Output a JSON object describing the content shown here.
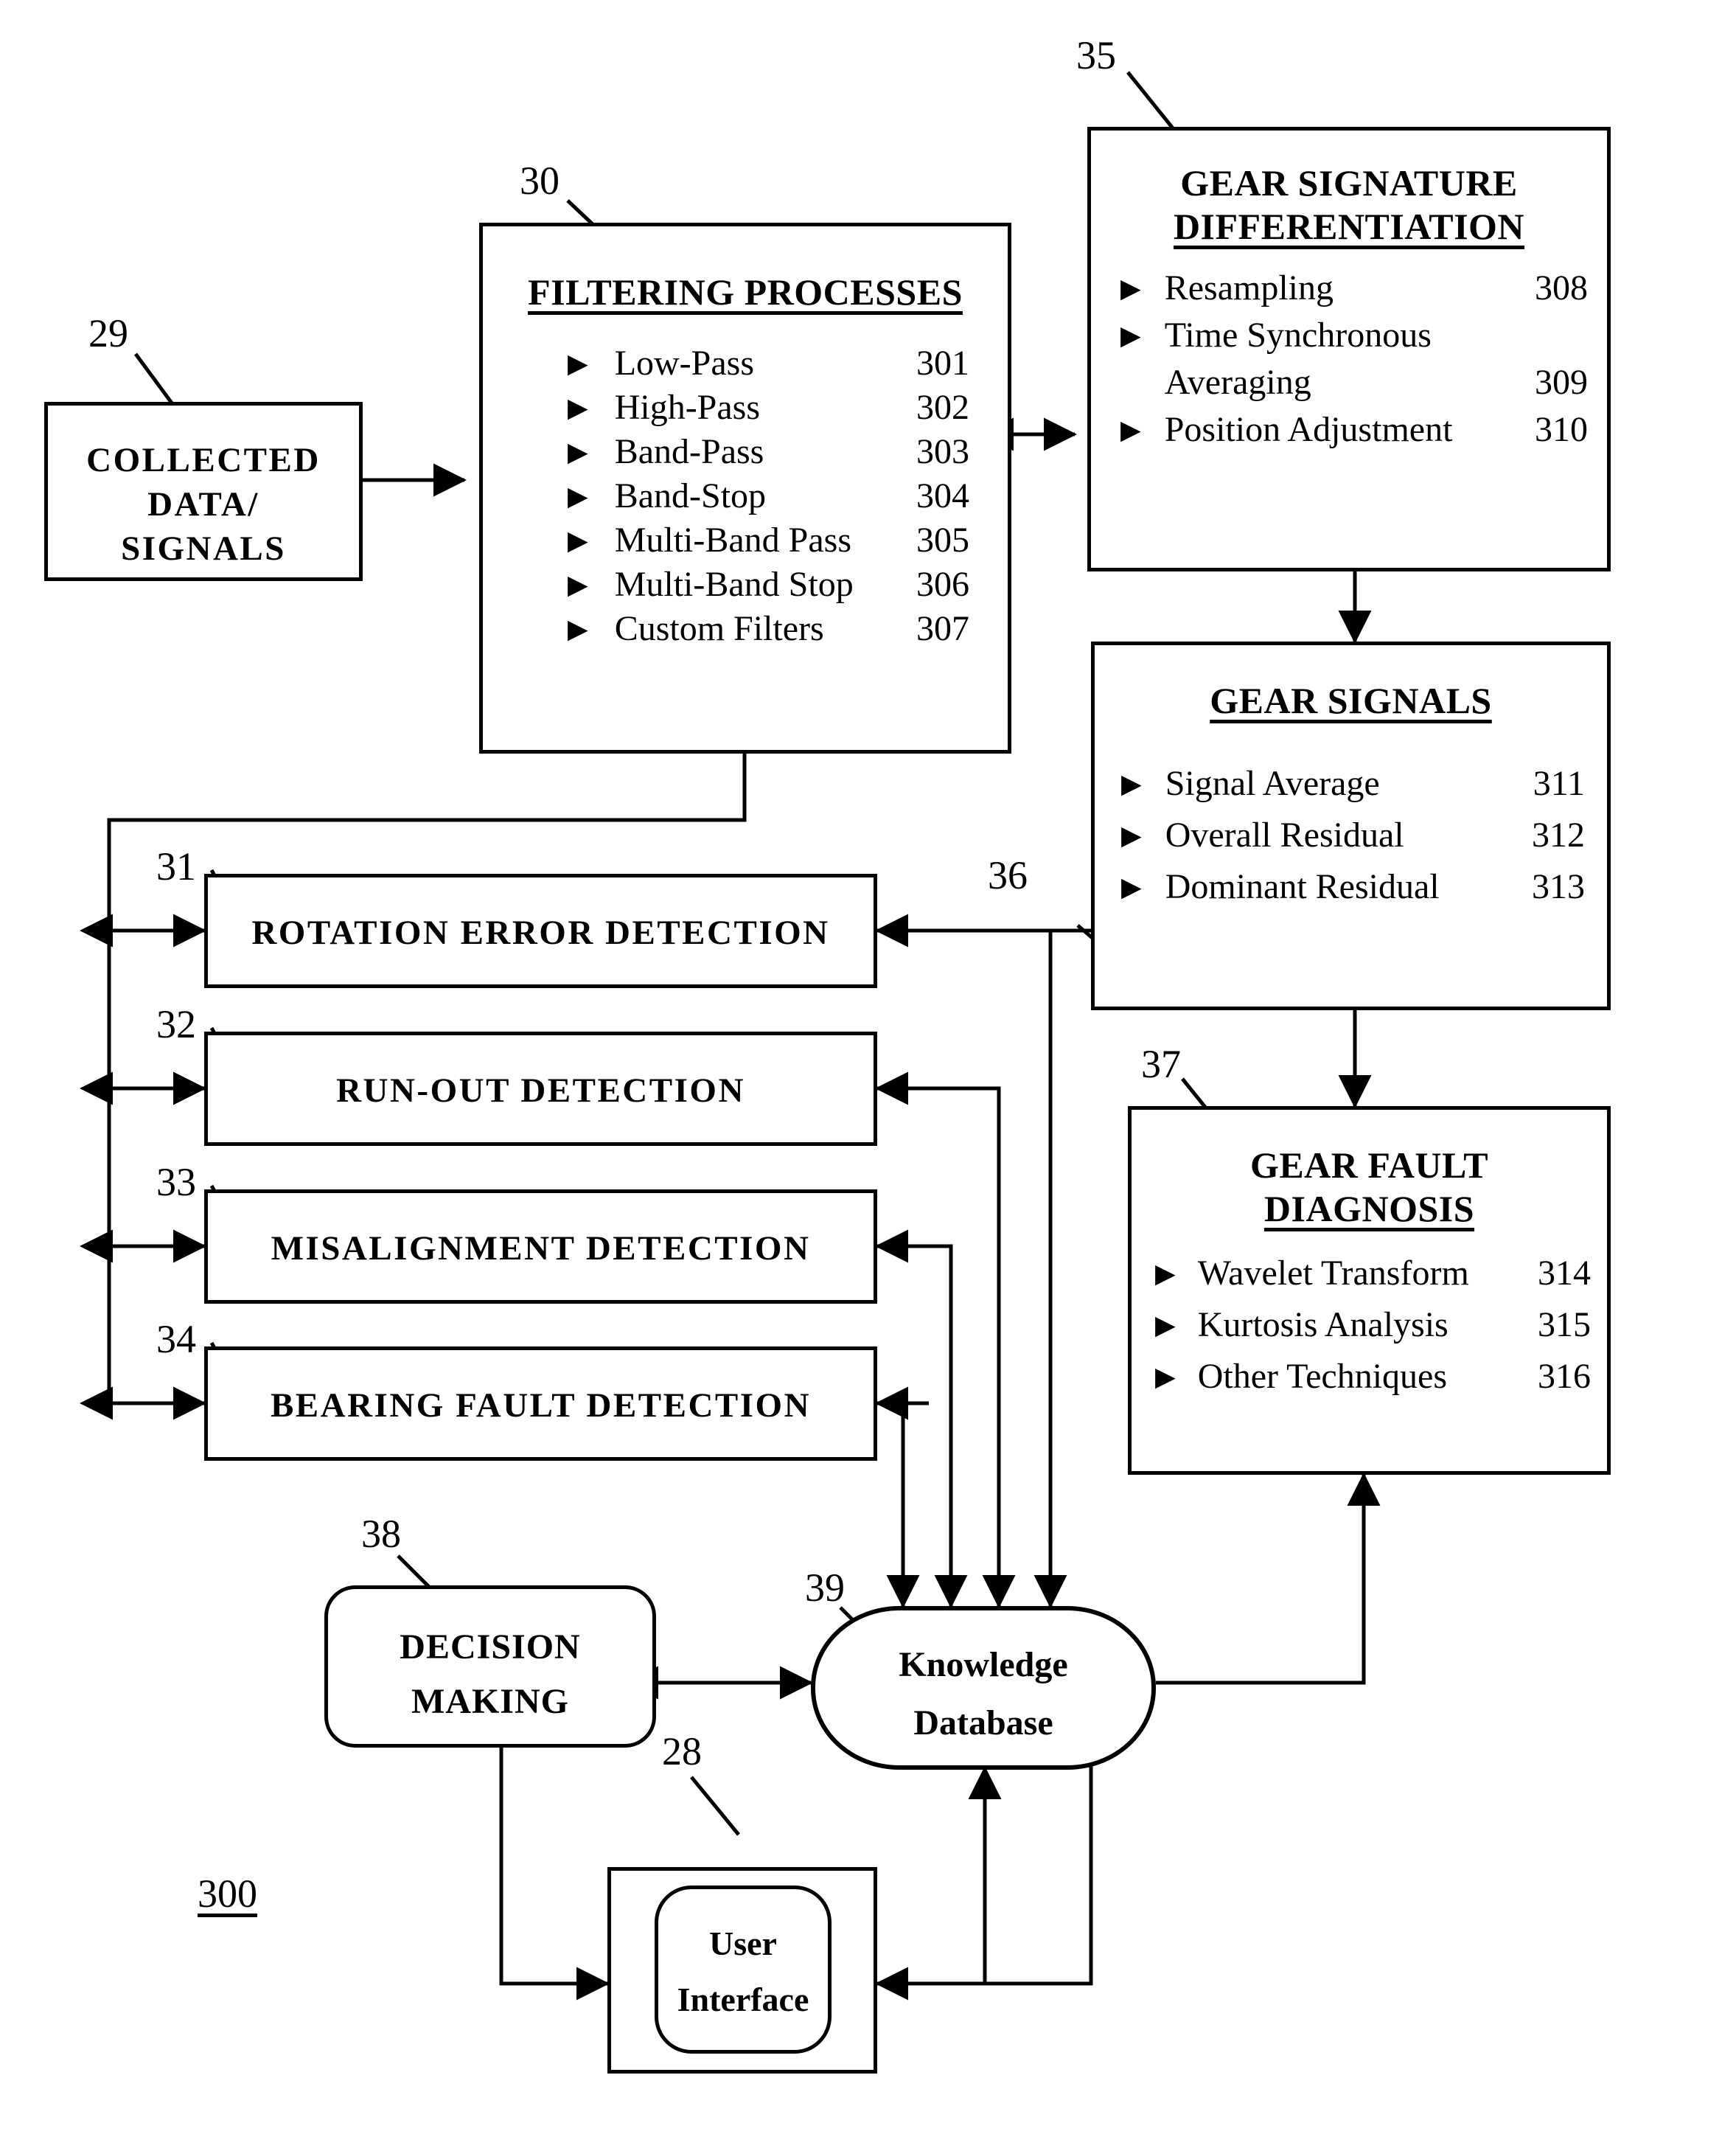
{
  "figure": {
    "number": "300"
  },
  "blocks": {
    "collected_data": {
      "ref": "29",
      "lines": [
        "COLLECTED",
        "DATA/",
        "SIGNALS"
      ]
    },
    "filtering_processes": {
      "ref": "30",
      "title": "FILTERING PROCESSES",
      "items": [
        {
          "bullet": "▶",
          "label": "Low-Pass",
          "num": "301"
        },
        {
          "bullet": "▶",
          "label": "High-Pass",
          "num": "302"
        },
        {
          "bullet": "▶",
          "label": "Band-Pass",
          "num": "303"
        },
        {
          "bullet": "▶",
          "label": "Band-Stop",
          "num": "304"
        },
        {
          "bullet": "▶",
          "label": "Multi-Band Pass",
          "num": "305"
        },
        {
          "bullet": "▶",
          "label": "Multi-Band Stop",
          "num": "306"
        },
        {
          "bullet": "▶",
          "label": "Custom Filters",
          "num": "307"
        }
      ]
    },
    "gear_signature_differentiation": {
      "ref": "35",
      "title_line1": "GEAR SIGNATURE",
      "title_line2": "DIFFERENTIATION",
      "items": [
        {
          "bullet": "▶",
          "label": "Resampling",
          "num": "308"
        },
        {
          "bullet": "▶",
          "label": "Time Synchronous",
          "num": ""
        },
        {
          "bullet": "",
          "label": "Averaging",
          "num": "309"
        },
        {
          "bullet": "▶",
          "label": "Position Adjustment",
          "num": "310"
        }
      ]
    },
    "gear_signals": {
      "ref": "36",
      "title": "GEAR  SIGNALS",
      "items": [
        {
          "bullet": "▶",
          "label": "Signal Average",
          "num": "311"
        },
        {
          "bullet": "▶",
          "label": "Overall Residual",
          "num": "312"
        },
        {
          "bullet": "▶",
          "label": "Dominant Residual",
          "num": "313"
        }
      ]
    },
    "gear_fault_diagnosis": {
      "ref": "37",
      "title_line1": "GEAR  FAULT",
      "title_line2": "DIAGNOSIS",
      "items": [
        {
          "bullet": "▶",
          "label": "Wavelet Transform",
          "num": "314"
        },
        {
          "bullet": "▶",
          "label": "Kurtosis Analysis",
          "num": "315"
        },
        {
          "bullet": "▶",
          "label": "Other Techniques",
          "num": "316"
        }
      ]
    },
    "rotation_error_detection": {
      "ref": "31",
      "label": "ROTATION  ERROR  DETECTION"
    },
    "run_out_detection": {
      "ref": "32",
      "label": "RUN-OUT  DETECTION"
    },
    "misalignment_detection": {
      "ref": "33",
      "label": "MISALIGNMENT  DETECTION"
    },
    "bearing_fault_detection": {
      "ref": "34",
      "label": "BEARING  FAULT  DETECTION"
    },
    "decision_making": {
      "ref": "38",
      "line1": "DECISION",
      "line2": "MAKING"
    },
    "knowledge_database": {
      "ref": "39",
      "line1": "Knowledge",
      "line2": "Database"
    },
    "user_interface": {
      "ref": "28",
      "line1": "User",
      "line2": "Interface"
    }
  }
}
